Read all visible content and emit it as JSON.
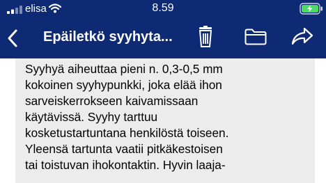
{
  "status_bar": {
    "carrier": "elisa",
    "time": "8.59"
  },
  "nav": {
    "title": "Epäiletkö syyhyta..."
  },
  "message": {
    "lines": [
      "Syyhyä aiheuttaa pieni n. 0,3-0,5 mm",
      "kokoinen syyhypunkki, joka elää ihon",
      "sarveiskerrokseen kaivamissaan",
      "käytävissä. Syyhy tarttuu",
      "kosketustartuntana henkilöstä toiseen.",
      "Yleensä tartunta vaatii pitkäkestoisen",
      "tai toistuvan ihokontaktin. Hyvin laaja-"
    ]
  },
  "colors": {
    "header_bg": "#0f2a74",
    "message_bg": "#ececec",
    "battery_green": "#4cd964"
  },
  "icons": [
    "signal-icon",
    "wifi-icon",
    "battery-charging-icon",
    "back-arrow-icon",
    "trash-icon",
    "folder-icon",
    "share-icon"
  ]
}
